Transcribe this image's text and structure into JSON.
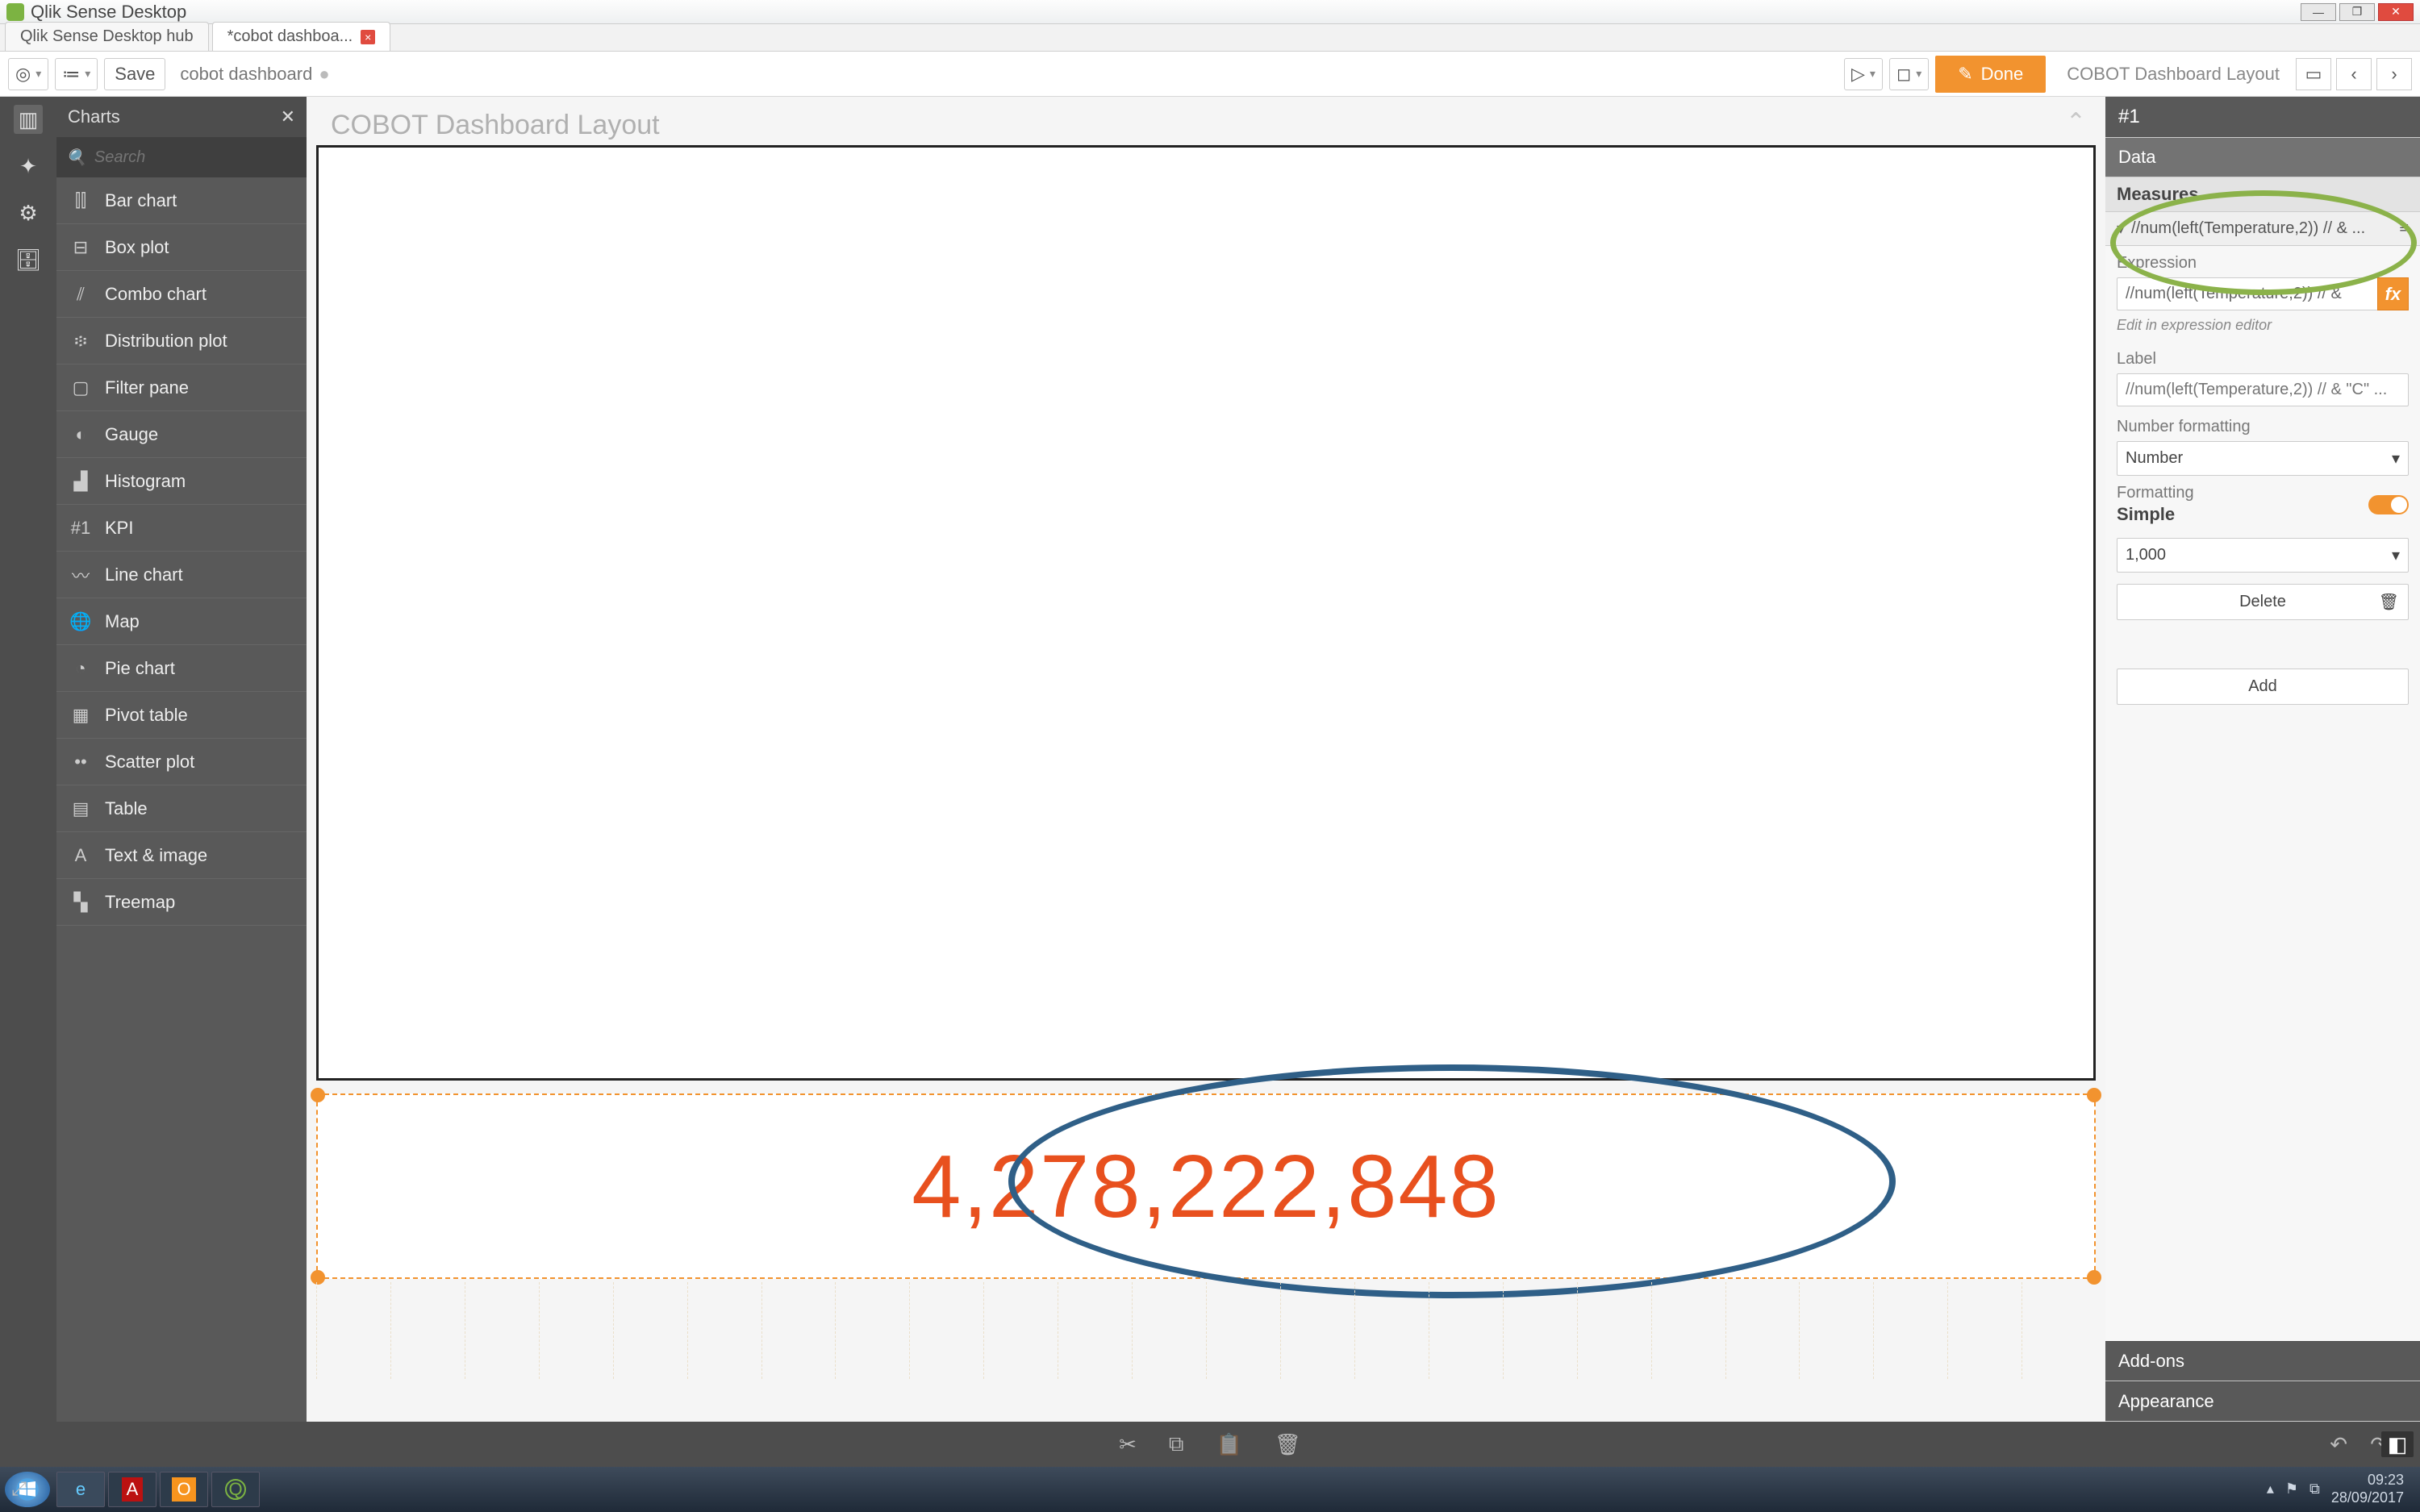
{
  "window": {
    "title": "Qlik Sense Desktop"
  },
  "tabs": [
    {
      "label": "Qlik Sense Desktop hub",
      "active": false
    },
    {
      "label": "*cobot dashboa...",
      "active": true
    }
  ],
  "toolbar": {
    "save": "Save",
    "app_name": "cobot dashboard",
    "done": "Done",
    "sheet_title_right": "COBOT Dashboard Layout"
  },
  "assets": {
    "header": "Charts",
    "search_placeholder": "Search",
    "items": [
      "Bar chart",
      "Box plot",
      "Combo chart",
      "Distribution plot",
      "Filter pane",
      "Gauge",
      "Histogram",
      "KPI",
      "Line chart",
      "Map",
      "Pie chart",
      "Pivot table",
      "Scatter plot",
      "Table",
      "Text & image",
      "Treemap"
    ]
  },
  "canvas": {
    "sheet_title": "COBOT Dashboard Layout",
    "kpi_value": "4,278,222,848"
  },
  "props": {
    "header": "#1",
    "section_data": "Data",
    "measures_label": "Measures",
    "measure_summary": "//num(left(Temperature,2)) // & ...",
    "expression_label": "Expression",
    "expression_value": "//num(left(Temperature,2)) // &",
    "expression_hint": "Edit in expression editor",
    "label_label": "Label",
    "label_placeholder": "//num(left(Temperature,2)) // & \"C\" ...",
    "numfmt_label": "Number formatting",
    "numfmt_value": "Number",
    "formatting_label": "Formatting",
    "formatting_mode": "Simple",
    "format_pattern": "1,000",
    "delete": "Delete",
    "add": "Add",
    "addons": "Add-ons",
    "appearance": "Appearance"
  },
  "tray": {
    "time": "09:23",
    "date": "28/09/2017"
  },
  "icons": {
    "chart_icons": [
      "⫿⫿",
      "⊟",
      "⫽",
      "፨",
      "▢",
      "◐",
      "▟",
      "#1",
      "〰",
      "🌐",
      "◔",
      "▦",
      "••",
      "▤",
      "A",
      "▚"
    ]
  }
}
